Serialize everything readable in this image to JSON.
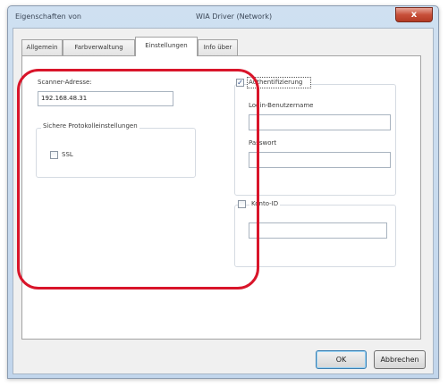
{
  "window": {
    "title_prefix": "Eigenschaften von",
    "title_app": "WIA Driver (Network)",
    "close_glyph": "x"
  },
  "tabs": [
    {
      "label": "Allgemein",
      "active": false
    },
    {
      "label": "Farbverwaltung",
      "active": false
    },
    {
      "label": "Einstellungen",
      "active": true
    },
    {
      "label": "Info über",
      "active": false
    }
  ],
  "scanner": {
    "address_label": "Scanner-Adresse:",
    "address_value": "192.168.48.31"
  },
  "protocol": {
    "group_label": "Sichere Protokolleinstellungen",
    "ssl_label": "SSL",
    "ssl_checked": false
  },
  "authentication": {
    "label": "Authentifizierung",
    "checked": true,
    "check_glyph": "✓",
    "username_label": "Login-Benutzername",
    "username_value": "",
    "password_label": "Passwort",
    "password_value": ""
  },
  "account": {
    "label": "Konto-ID",
    "checked": false,
    "value": ""
  },
  "buttons": {
    "ok": "OK",
    "cancel": "Abbrechen"
  },
  "colors": {
    "highlight": "#d9152a",
    "close_button": "#c8503a",
    "checkmark": "#2b4a86"
  }
}
